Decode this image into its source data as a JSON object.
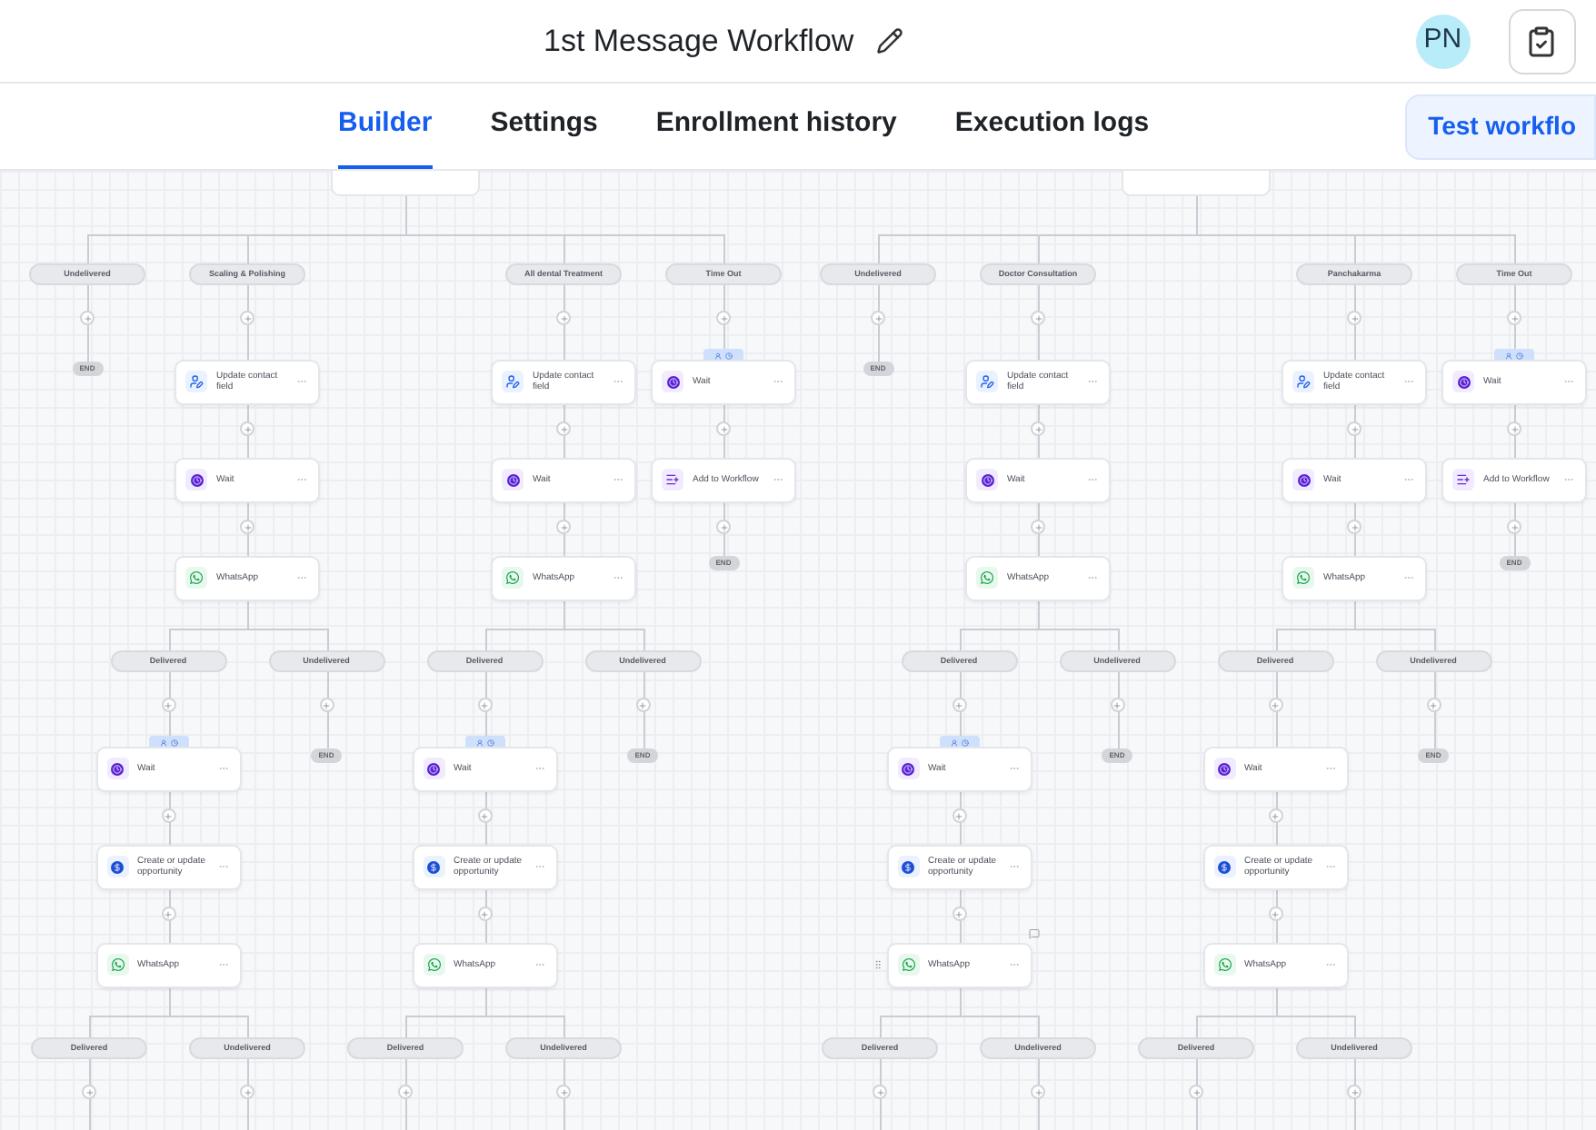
{
  "header": {
    "title": "1st Message Workflow",
    "avatar": "PN"
  },
  "tabs": [
    {
      "label": "Builder",
      "selected": true
    },
    {
      "label": "Settings",
      "selected": false
    },
    {
      "label": "Enrollment history",
      "selected": false
    },
    {
      "label": "Execution logs",
      "selected": false
    }
  ],
  "test_button": "Test workflo",
  "canvas": {
    "groups": [
      {
        "branches": [
          {
            "label": "Undelivered",
            "steps": [
              {
                "kind": "end",
                "label": "END"
              }
            ]
          },
          {
            "label": "Scaling & Polishing",
            "steps": [
              {
                "kind": "update_contact",
                "label": "Update contact field"
              },
              {
                "kind": "wait",
                "label": "Wait",
                "tagged": false
              },
              {
                "kind": "whatsapp",
                "label": "WhatsApp",
                "hovered": false
              }
            ],
            "split": [
              {
                "label": "Delivered",
                "steps": [
                  {
                    "kind": "wait",
                    "label": "Wait",
                    "tagged": true
                  },
                  {
                    "kind": "opportunity",
                    "label": "Create or update opportunity"
                  },
                  {
                    "kind": "whatsapp",
                    "label": "WhatsApp",
                    "hovered": false
                  }
                ],
                "split": [
                  {
                    "label": "Delivered"
                  },
                  {
                    "label": "Undelivered"
                  }
                ]
              },
              {
                "label": "Undelivered",
                "steps": [
                  {
                    "kind": "end",
                    "label": "END"
                  }
                ]
              }
            ]
          },
          {
            "label": "All dental Treatment",
            "steps": [
              {
                "kind": "update_contact",
                "label": "Update contact field"
              },
              {
                "kind": "wait",
                "label": "Wait",
                "tagged": false
              },
              {
                "kind": "whatsapp",
                "label": "WhatsApp",
                "hovered": false
              }
            ],
            "split": [
              {
                "label": "Delivered",
                "steps": [
                  {
                    "kind": "wait",
                    "label": "Wait",
                    "tagged": true
                  },
                  {
                    "kind": "opportunity",
                    "label": "Create or update opportunity"
                  },
                  {
                    "kind": "whatsapp",
                    "label": "WhatsApp",
                    "hovered": false
                  }
                ],
                "split": [
                  {
                    "label": "Delivered"
                  },
                  {
                    "label": "Undelivered"
                  }
                ]
              },
              {
                "label": "Undelivered",
                "steps": [
                  {
                    "kind": "end",
                    "label": "END"
                  }
                ]
              }
            ]
          },
          {
            "label": "Time Out",
            "steps": [
              {
                "kind": "wait",
                "label": "Wait",
                "tagged": true
              },
              {
                "kind": "add_workflow",
                "label": "Add to Workflow"
              },
              {
                "kind": "end",
                "label": "END"
              }
            ]
          }
        ]
      },
      {
        "branches": [
          {
            "label": "Undelivered",
            "steps": [
              {
                "kind": "end",
                "label": "END"
              }
            ]
          },
          {
            "label": "Doctor Consultation",
            "steps": [
              {
                "kind": "update_contact",
                "label": "Update contact field"
              },
              {
                "kind": "wait",
                "label": "Wait",
                "tagged": false
              },
              {
                "kind": "whatsapp",
                "label": "WhatsApp",
                "hovered": false
              }
            ],
            "split": [
              {
                "label": "Delivered",
                "steps": [
                  {
                    "kind": "wait",
                    "label": "Wait",
                    "tagged": true
                  },
                  {
                    "kind": "opportunity",
                    "label": "Create or update opportunity"
                  },
                  {
                    "kind": "whatsapp",
                    "label": "WhatsApp",
                    "hovered": true
                  }
                ],
                "split": [
                  {
                    "label": "Delivered"
                  },
                  {
                    "label": "Undelivered"
                  }
                ]
              },
              {
                "label": "Undelivered",
                "steps": [
                  {
                    "kind": "end",
                    "label": "END"
                  }
                ]
              }
            ]
          },
          {
            "label": "Panchakarma",
            "steps": [
              {
                "kind": "update_contact",
                "label": "Update contact field"
              },
              {
                "kind": "wait",
                "label": "Wait",
                "tagged": false
              },
              {
                "kind": "whatsapp",
                "label": "WhatsApp",
                "hovered": false
              }
            ],
            "split": [
              {
                "label": "Delivered",
                "steps": [
                  {
                    "kind": "wait",
                    "label": "Wait",
                    "tagged": false
                  },
                  {
                    "kind": "opportunity",
                    "label": "Create or update opportunity"
                  },
                  {
                    "kind": "whatsapp",
                    "label": "WhatsApp",
                    "hovered": false
                  }
                ],
                "split": [
                  {
                    "label": "Delivered"
                  },
                  {
                    "label": "Undelivered"
                  }
                ]
              },
              {
                "label": "Undelivered",
                "steps": [
                  {
                    "kind": "end",
                    "label": "END"
                  }
                ]
              }
            ]
          },
          {
            "label": "Time Out",
            "steps": [
              {
                "kind": "wait",
                "label": "Wait",
                "tagged": true
              },
              {
                "kind": "add_workflow",
                "label": "Add to Workflow"
              },
              {
                "kind": "end",
                "label": "END"
              }
            ]
          }
        ]
      }
    ]
  }
}
